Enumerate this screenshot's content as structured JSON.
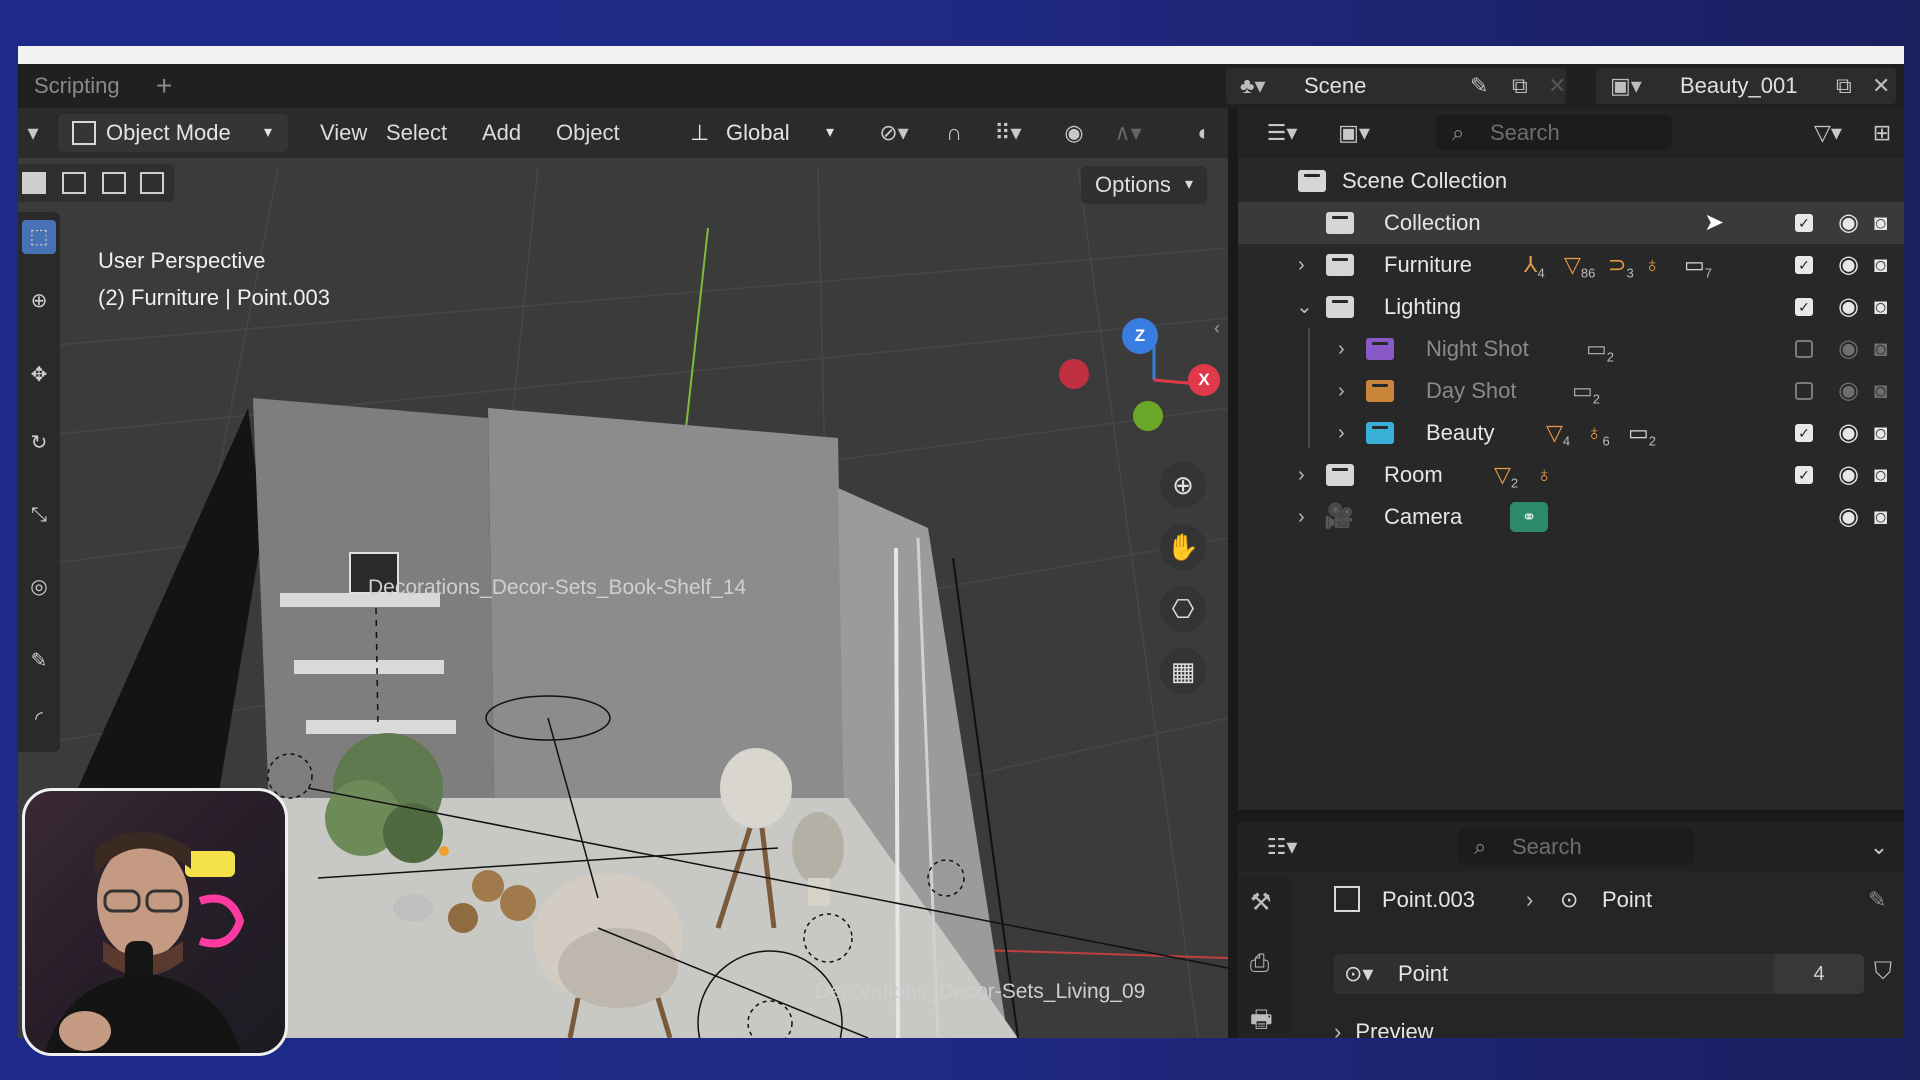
{
  "workspace": {
    "tab": "Scripting",
    "add": "+"
  },
  "header": {
    "scene": "Scene",
    "view_layer": "Beauty_001"
  },
  "viewport": {
    "mode": "Object Mode",
    "menus": [
      "View",
      "Select",
      "Add",
      "Object"
    ],
    "transform": "Global",
    "options": "Options",
    "info_line1": "User Perspective",
    "info_line2": "(2) Furniture | Point.003",
    "labels": {
      "shelf": "Decorations_Decor-Sets_Book-Shelf_14",
      "living": "Decorations_Decor-Sets_Living_09"
    },
    "gizmo": {
      "z": "Z",
      "x": "X"
    }
  },
  "outliner": {
    "search_placeholder": "Search",
    "root": "Scene Collection",
    "items": [
      {
        "label": "Collection",
        "checked": true
      },
      {
        "label": "Furniture",
        "checked": true,
        "counts": [
          "4",
          "86",
          "3",
          "7"
        ]
      },
      {
        "label": "Lighting",
        "checked": true
      },
      {
        "label": "Night Shot",
        "checked": false,
        "counts": [
          "2"
        ]
      },
      {
        "label": "Day Shot",
        "checked": false,
        "counts": [
          "2"
        ]
      },
      {
        "label": "Beauty",
        "checked": true,
        "counts": [
          "4",
          "6",
          "2"
        ]
      },
      {
        "label": "Room",
        "checked": true,
        "counts": [
          "2"
        ]
      },
      {
        "label": "Camera"
      }
    ],
    "colors": {
      "collection": "#d6d6d6",
      "night": "#8a5ac8",
      "day": "#c9853a",
      "beauty": "#3ab0d8",
      "accent": "#e59a45"
    }
  },
  "properties": {
    "search_placeholder": "Search",
    "object": "Point.003",
    "data": "Point",
    "field_name": "Point",
    "field_count": "4",
    "preview": "Preview"
  }
}
